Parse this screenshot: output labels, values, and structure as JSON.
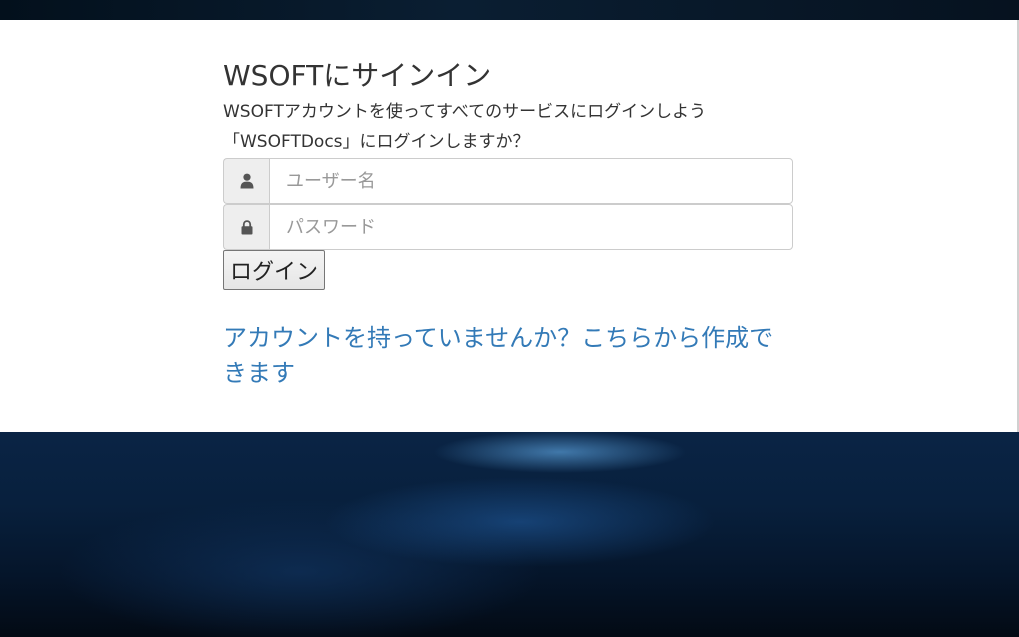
{
  "page": {
    "title": "WSOFTにサインイン",
    "subtitle": "WSOFTアカウントを使ってすべてのサービスにログインしよう",
    "question": "「WSOFTDocs」にログインしますか？"
  },
  "form": {
    "username_placeholder": "ユーザー名",
    "password_placeholder": "パスワード",
    "username_icon": "user-icon",
    "password_icon": "lock-icon",
    "login_label": "ログイン"
  },
  "signup": {
    "link_text": "アカウントを持っていませんか？こちらから作成できます"
  },
  "colors": {
    "link": "#337ab7",
    "text": "#333333",
    "addon_bg": "#eeeeee",
    "card_bg": "#ffffff"
  }
}
